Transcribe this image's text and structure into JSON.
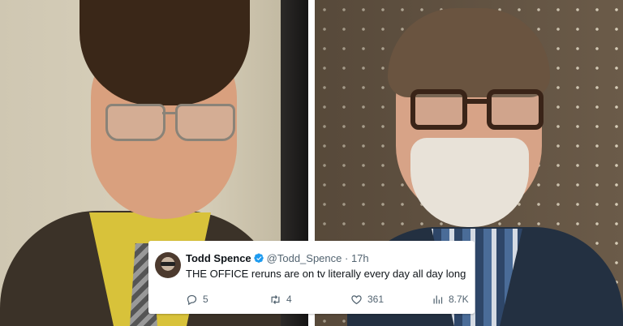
{
  "tweet": {
    "display_name": "Todd Spence",
    "handle": "@Todd_Spence",
    "separator": "·",
    "time": "17h",
    "text": "THE OFFICE reruns are on tv literally every day all day long",
    "replies": "5",
    "retweets": "4",
    "likes": "361",
    "views": "8.7K",
    "verified_color": "#1d9bf0",
    "icons": [
      "reply-icon",
      "retweet-icon",
      "like-icon",
      "views-icon"
    ]
  }
}
